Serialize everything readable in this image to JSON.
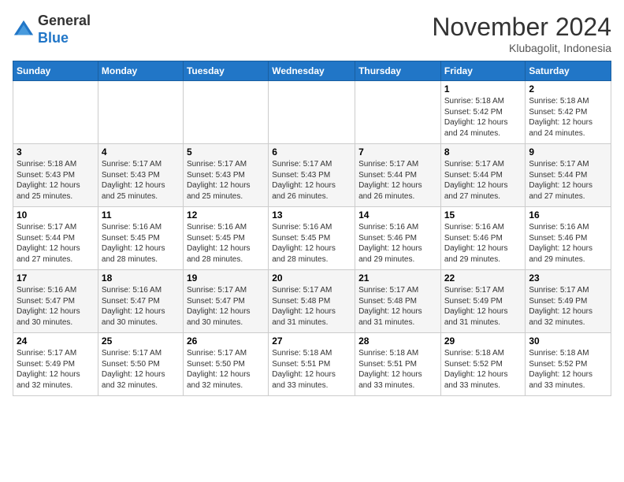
{
  "header": {
    "logo": {
      "line1": "General",
      "line2": "Blue"
    },
    "title": "November 2024",
    "location": "Klubagolit, Indonesia"
  },
  "weekdays": [
    "Sunday",
    "Monday",
    "Tuesday",
    "Wednesday",
    "Thursday",
    "Friday",
    "Saturday"
  ],
  "weeks": [
    [
      {
        "day": "",
        "info": ""
      },
      {
        "day": "",
        "info": ""
      },
      {
        "day": "",
        "info": ""
      },
      {
        "day": "",
        "info": ""
      },
      {
        "day": "",
        "info": ""
      },
      {
        "day": "1",
        "info": "Sunrise: 5:18 AM\nSunset: 5:42 PM\nDaylight: 12 hours\nand 24 minutes."
      },
      {
        "day": "2",
        "info": "Sunrise: 5:18 AM\nSunset: 5:42 PM\nDaylight: 12 hours\nand 24 minutes."
      }
    ],
    [
      {
        "day": "3",
        "info": "Sunrise: 5:18 AM\nSunset: 5:43 PM\nDaylight: 12 hours\nand 25 minutes."
      },
      {
        "day": "4",
        "info": "Sunrise: 5:17 AM\nSunset: 5:43 PM\nDaylight: 12 hours\nand 25 minutes."
      },
      {
        "day": "5",
        "info": "Sunrise: 5:17 AM\nSunset: 5:43 PM\nDaylight: 12 hours\nand 25 minutes."
      },
      {
        "day": "6",
        "info": "Sunrise: 5:17 AM\nSunset: 5:43 PM\nDaylight: 12 hours\nand 26 minutes."
      },
      {
        "day": "7",
        "info": "Sunrise: 5:17 AM\nSunset: 5:44 PM\nDaylight: 12 hours\nand 26 minutes."
      },
      {
        "day": "8",
        "info": "Sunrise: 5:17 AM\nSunset: 5:44 PM\nDaylight: 12 hours\nand 27 minutes."
      },
      {
        "day": "9",
        "info": "Sunrise: 5:17 AM\nSunset: 5:44 PM\nDaylight: 12 hours\nand 27 minutes."
      }
    ],
    [
      {
        "day": "10",
        "info": "Sunrise: 5:17 AM\nSunset: 5:44 PM\nDaylight: 12 hours\nand 27 minutes."
      },
      {
        "day": "11",
        "info": "Sunrise: 5:16 AM\nSunset: 5:45 PM\nDaylight: 12 hours\nand 28 minutes."
      },
      {
        "day": "12",
        "info": "Sunrise: 5:16 AM\nSunset: 5:45 PM\nDaylight: 12 hours\nand 28 minutes."
      },
      {
        "day": "13",
        "info": "Sunrise: 5:16 AM\nSunset: 5:45 PM\nDaylight: 12 hours\nand 28 minutes."
      },
      {
        "day": "14",
        "info": "Sunrise: 5:16 AM\nSunset: 5:46 PM\nDaylight: 12 hours\nand 29 minutes."
      },
      {
        "day": "15",
        "info": "Sunrise: 5:16 AM\nSunset: 5:46 PM\nDaylight: 12 hours\nand 29 minutes."
      },
      {
        "day": "16",
        "info": "Sunrise: 5:16 AM\nSunset: 5:46 PM\nDaylight: 12 hours\nand 29 minutes."
      }
    ],
    [
      {
        "day": "17",
        "info": "Sunrise: 5:16 AM\nSunset: 5:47 PM\nDaylight: 12 hours\nand 30 minutes."
      },
      {
        "day": "18",
        "info": "Sunrise: 5:16 AM\nSunset: 5:47 PM\nDaylight: 12 hours\nand 30 minutes."
      },
      {
        "day": "19",
        "info": "Sunrise: 5:17 AM\nSunset: 5:47 PM\nDaylight: 12 hours\nand 30 minutes."
      },
      {
        "day": "20",
        "info": "Sunrise: 5:17 AM\nSunset: 5:48 PM\nDaylight: 12 hours\nand 31 minutes."
      },
      {
        "day": "21",
        "info": "Sunrise: 5:17 AM\nSunset: 5:48 PM\nDaylight: 12 hours\nand 31 minutes."
      },
      {
        "day": "22",
        "info": "Sunrise: 5:17 AM\nSunset: 5:49 PM\nDaylight: 12 hours\nand 31 minutes."
      },
      {
        "day": "23",
        "info": "Sunrise: 5:17 AM\nSunset: 5:49 PM\nDaylight: 12 hours\nand 32 minutes."
      }
    ],
    [
      {
        "day": "24",
        "info": "Sunrise: 5:17 AM\nSunset: 5:49 PM\nDaylight: 12 hours\nand 32 minutes."
      },
      {
        "day": "25",
        "info": "Sunrise: 5:17 AM\nSunset: 5:50 PM\nDaylight: 12 hours\nand 32 minutes."
      },
      {
        "day": "26",
        "info": "Sunrise: 5:17 AM\nSunset: 5:50 PM\nDaylight: 12 hours\nand 32 minutes."
      },
      {
        "day": "27",
        "info": "Sunrise: 5:18 AM\nSunset: 5:51 PM\nDaylight: 12 hours\nand 33 minutes."
      },
      {
        "day": "28",
        "info": "Sunrise: 5:18 AM\nSunset: 5:51 PM\nDaylight: 12 hours\nand 33 minutes."
      },
      {
        "day": "29",
        "info": "Sunrise: 5:18 AM\nSunset: 5:52 PM\nDaylight: 12 hours\nand 33 minutes."
      },
      {
        "day": "30",
        "info": "Sunrise: 5:18 AM\nSunset: 5:52 PM\nDaylight: 12 hours\nand 33 minutes."
      }
    ]
  ]
}
